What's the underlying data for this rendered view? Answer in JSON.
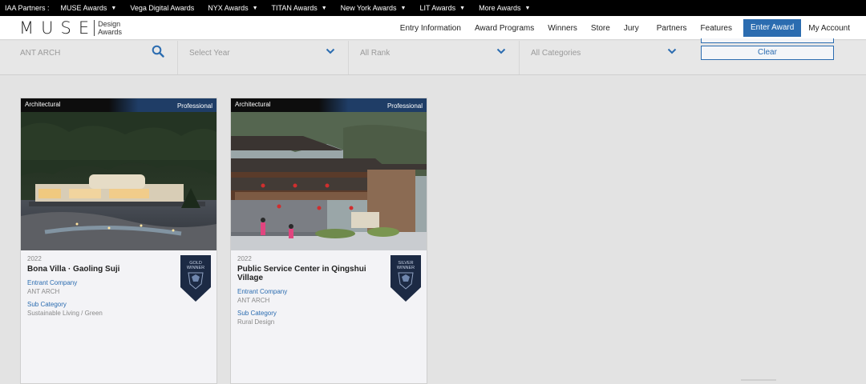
{
  "partners": {
    "label": "IAA Partners :",
    "items": [
      "MUSE Awards",
      "Vega Digital Awards",
      "NYX Awards",
      "TITAN Awards",
      "New York Awards",
      "LIT Awards",
      "More Awards"
    ]
  },
  "logo": {
    "word": "MUSE",
    "line1": "Design",
    "line2": "Awards"
  },
  "nav": {
    "items": [
      "Entry Information",
      "Award Programs",
      "Winners",
      "Store",
      "Jury",
      "Partners",
      "Features"
    ],
    "enter": "Enter Award",
    "account": "My Account"
  },
  "filters": {
    "search": "ANT ARCH",
    "year": "Select Year",
    "rank": "All Rank",
    "category": "All Categories",
    "clear": "Clear"
  },
  "colors": {
    "accent": "#2b6cb0",
    "topbar": "#000000",
    "badge": "#1c2a44"
  },
  "cards": [
    {
      "category": "Architectural",
      "level": "Professional",
      "year": "2022",
      "title": "Bona Villa · Gaoling Suji",
      "entrant_label": "Entrant Company",
      "entrant": "ANT ARCH",
      "sub_label": "Sub Category",
      "sub": "Sustainable Living / Green",
      "badge_l1": "GOLD",
      "badge_l2": "WINNER"
    },
    {
      "category": "Architectural",
      "level": "Professional",
      "year": "2022",
      "title": "Public Service Center in Qingshui Village",
      "entrant_label": "Entrant Company",
      "entrant": "ANT ARCH",
      "sub_label": "Sub Category",
      "sub": "Rural Design",
      "badge_l1": "SILVER",
      "badge_l2": "WINNER"
    }
  ]
}
